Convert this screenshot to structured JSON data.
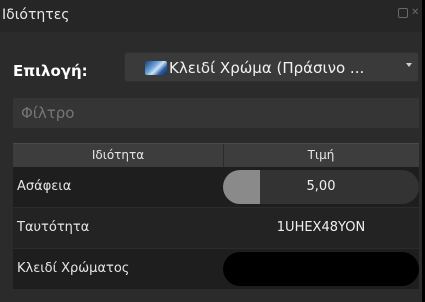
{
  "panel": {
    "title": "Ιδιότητες"
  },
  "selector": {
    "label": "Επιλογή:",
    "value": "Κλειδί Χρώμα (Πράσινο ...",
    "icon": "chroma-key-icon"
  },
  "filter": {
    "placeholder": "Φίλτρο"
  },
  "table": {
    "headers": [
      "Ιδιότητα",
      "Τιμή"
    ],
    "rows": [
      {
        "label": "Ασάφεια",
        "value": "5,00",
        "slider_fraction": 0.05
      },
      {
        "label": "Ταυτότητα",
        "value": "1UHEX48YON"
      },
      {
        "label": "Κλειδί Χρώματος",
        "color": "#000000"
      }
    ]
  }
}
